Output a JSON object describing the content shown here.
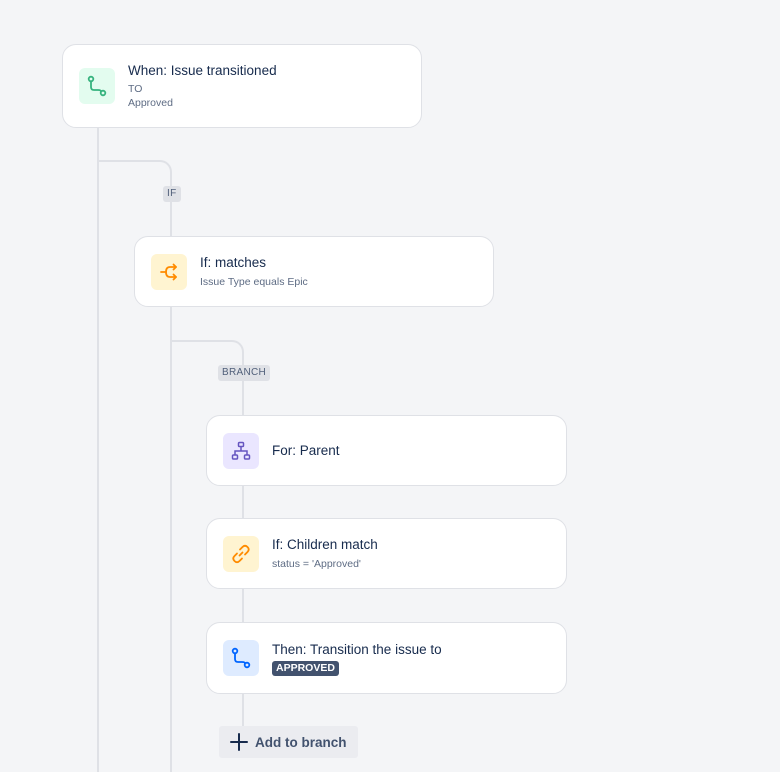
{
  "trigger": {
    "title": "When: Issue transitioned",
    "to_label": "TO",
    "to_value": "Approved",
    "icon": "transition-icon",
    "icon_color": "#36b37e"
  },
  "if_label": "IF",
  "condition": {
    "title": "If: matches",
    "subtitle": "Issue Type equals Epic",
    "icon": "condition-branch-icon",
    "icon_color": "#ff8b00"
  },
  "branch_label": "BRANCH",
  "branch": {
    "title": "For: Parent",
    "icon": "hierarchy-icon",
    "icon_color": "#6554c0"
  },
  "children_condition": {
    "title": "If: Children match",
    "subtitle": "status = 'Approved'",
    "icon": "link-icon",
    "icon_color": "#ff8b00"
  },
  "action": {
    "title": "Then: Transition the issue to",
    "status": "APPROVED",
    "icon": "transition-icon",
    "icon_color": "#0065ff"
  },
  "add_branch": {
    "label": "Add to branch",
    "icon": "plus-icon"
  }
}
